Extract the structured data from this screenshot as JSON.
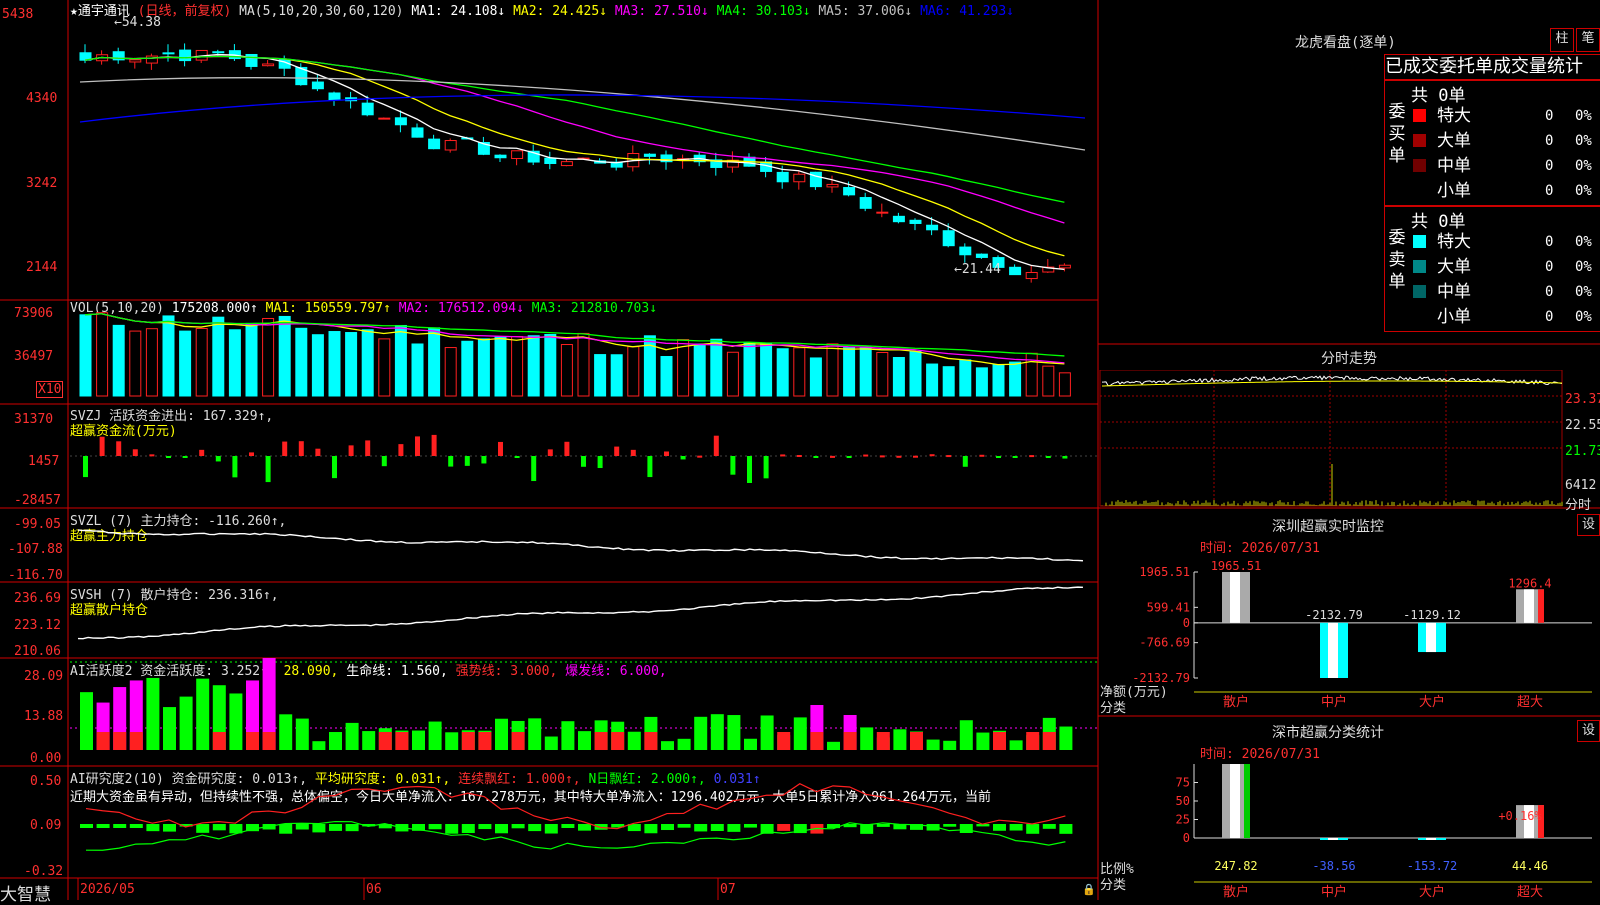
{
  "colors": {
    "up": "#ff2020",
    "down": "#00ffff",
    "frame": "#d00000",
    "ma1": "#ffffff",
    "ma2": "#ffff00",
    "ma3": "#ff00ff",
    "ma4": "#00ff00",
    "ma5": "#c0c0c0",
    "ma6": "#0000ff",
    "green": "#00ff00",
    "magenta": "#ff00ff"
  },
  "price_panel": {
    "title": "★通宇通讯",
    "period": "(日线，前复权)",
    "ma_params": "MA(5,10,20,30,60,120)",
    "ma": [
      {
        "label": "MA1: 24.108↓",
        "color": "#ffffff"
      },
      {
        "label": "MA2: 24.425↓",
        "color": "#ffff00"
      },
      {
        "label": "MA3: 27.510↓",
        "color": "#ff00ff"
      },
      {
        "label": "MA4: 30.103↓",
        "color": "#00ff00"
      },
      {
        "label": "MA5: 37.006↓",
        "color": "#c0c0c0"
      },
      {
        "label": "MA6: 41.293↓",
        "color": "#0000ff"
      }
    ],
    "y_ticks": [
      "5438",
      "4340",
      "3242",
      "2144"
    ],
    "high_label": "←54.38",
    "low_label": "←21.44"
  },
  "volume_panel": {
    "params": "VOL(5,10,20)",
    "value": "175208.000↑",
    "ma": [
      {
        "label": "MA1: 150559.797↑",
        "color": "#ffff00"
      },
      {
        "label": "MA2: 176512.094↓",
        "color": "#ff00ff"
      },
      {
        "label": "MA3: 212810.703↓",
        "color": "#00ff00"
      }
    ],
    "y_ticks": [
      "73906",
      "36497"
    ],
    "unit": "X10"
  },
  "svzj_panel": {
    "title": "SVZJ  活跃资金进出: 167.329↑,",
    "sub": "超赢资金流(万元)",
    "y_ticks": [
      "31370",
      "1457",
      "-28457"
    ]
  },
  "svzl_panel": {
    "title": "SVZL (7) 主力持仓: -116.260↑,",
    "sub": "超赢主力持仓",
    "y_ticks": [
      "-99.05",
      "-107.88",
      "-116.70"
    ]
  },
  "svsh_panel": {
    "title": "SVSH (7) 散户持仓: 236.316↑,",
    "sub": "超赢散户持仓",
    "y_ticks": [
      "236.69",
      "223.12",
      "210.06"
    ]
  },
  "ai1_panel": {
    "title": "AI活跃度2 资金活跃度: 3.252↑,",
    "v2": "28.090,",
    "v3": "生命线: 1.560,",
    "v4": "强势线: 3.000,",
    "v5": "爆发线: 6.000,",
    "y_ticks": [
      "28.09",
      "13.88",
      "0.00"
    ]
  },
  "ai2_panel": {
    "title": "AI研究度2(10) 资金研究度: 0.013↑,",
    "v2": "平均研究度: 0.031↑,",
    "v3": "连续飘红: 1.000↑,",
    "v4": "N日飘红: 2.000↑,",
    "v5": "0.031↑",
    "comment": "近期大资金虽有异动，但持续性不强，总体偏空，今日大单净流入：167.278万元，其中特大单净流入：1296.402万元，大单5日累计净入961.264万元，当前",
    "y_ticks": [
      "0.50",
      "0.09",
      "-0.32"
    ]
  },
  "bottom_axis": {
    "brand": "大智慧",
    "labels": [
      "2026/05",
      "06",
      "07"
    ]
  },
  "longhu": {
    "title": "龙虎看盘(逐单)",
    "btn1": "柱",
    "btn2": "笔",
    "header": "已成交委托单成交量统计",
    "buy": {
      "vlabel": [
        "委",
        "买",
        "单"
      ],
      "total": "共 0单",
      "rows": [
        {
          "name": "特大",
          "count": "0",
          "pct": "0%",
          "color": "#ff0000"
        },
        {
          "name": "大单",
          "count": "0",
          "pct": "0%",
          "color": "#a00000"
        },
        {
          "name": "中单",
          "count": "0",
          "pct": "0%",
          "color": "#700000"
        },
        {
          "name": "小单",
          "count": "0",
          "pct": "0%",
          "color": ""
        }
      ]
    },
    "sell": {
      "vlabel": [
        "委",
        "卖",
        "单"
      ],
      "total": "共 0单",
      "rows": [
        {
          "name": "特大",
          "count": "0",
          "pct": "0%",
          "color": "#00ffff"
        },
        {
          "name": "大单",
          "count": "0",
          "pct": "0%",
          "color": "#008888"
        },
        {
          "name": "中单",
          "count": "0",
          "pct": "0%",
          "color": "#006666"
        },
        {
          "name": "小单",
          "count": "0",
          "pct": "0%",
          "color": ""
        }
      ]
    }
  },
  "intraday": {
    "title": "分时走势",
    "price_ticks": [
      "23.37",
      "22.55",
      "21.73"
    ],
    "vol_tick": "6412",
    "vol_unit": "分时"
  },
  "monitor": {
    "title": "深圳超赢实时监控",
    "btn": "设",
    "time": "时间: 2026/07/31",
    "ylabel1": "净额(万元)",
    "ylabel2": "分类",
    "chart_data": {
      "type": "bar",
      "categories": [
        "散户",
        "中户",
        "大户",
        "超大"
      ],
      "values": [
        1965.51,
        -2132.79,
        -1129.12,
        1296.4
      ],
      "value_labels": [
        "1965.51",
        "-2132.79",
        "-1129.12",
        "1296.4"
      ],
      "y_ticks": [
        "1965.51",
        "599.41",
        "0",
        "-766.69",
        "-2132.79"
      ],
      "ylim": [
        -2132.79,
        1965.51
      ]
    }
  },
  "classify": {
    "title": "深市超赢分类统计",
    "btn": "设",
    "time": "时间: 2026/07/31",
    "ylabel1": "比例%",
    "ylabel2": "分类",
    "plus_label": "+0.16%",
    "chart_data": {
      "type": "bar",
      "categories": [
        "散户",
        "中户",
        "大户",
        "超大"
      ],
      "values": [
        247.82,
        -38.56,
        -153.72,
        44.46
      ],
      "value_labels": [
        "247.82",
        "-38.56",
        "-153.72",
        "44.46"
      ],
      "y_ticks": [
        "75",
        "50",
        "25",
        "0"
      ],
      "ylim": [
        0,
        100
      ]
    }
  }
}
